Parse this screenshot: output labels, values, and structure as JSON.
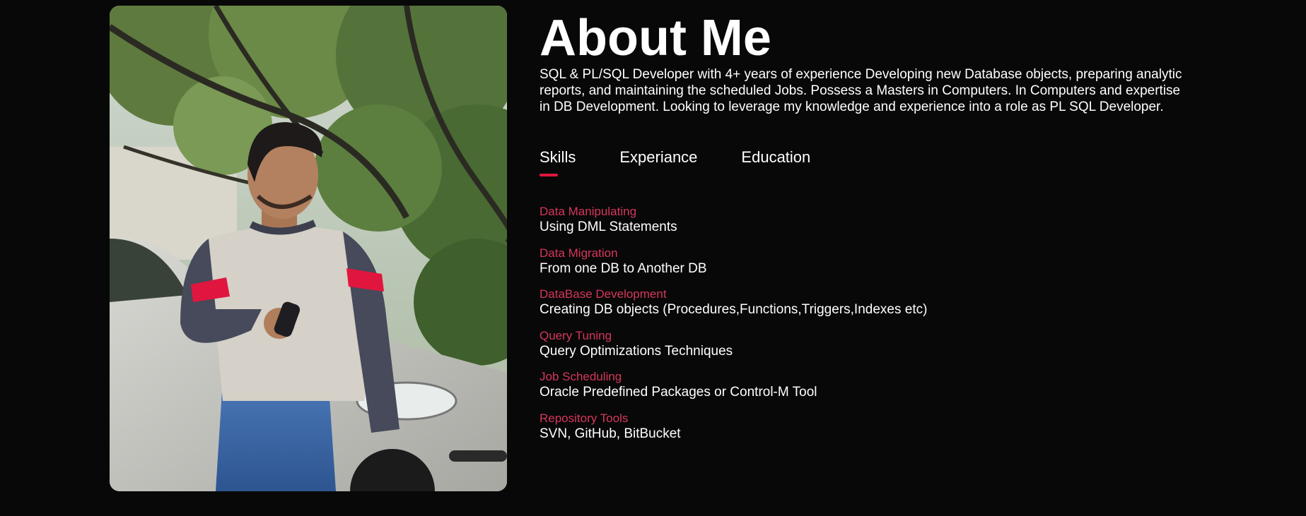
{
  "about": {
    "title": "About Me",
    "intro": "SQL & PL/SQL Developer with 4+ years of experience Developing new Database objects, preparing analytic reports, and maintaining the scheduled Jobs. Possess a Masters in Computers. In Computers and expertise in DB Development. Looking to leverage my knowledge and experience into a role as PL SQL Developer.",
    "photo_alt": "profile photo"
  },
  "tabs": [
    {
      "label": "Skills",
      "active": true
    },
    {
      "label": "Experiance",
      "active": false
    },
    {
      "label": "Education",
      "active": false
    }
  ],
  "skills": [
    {
      "name": "Data Manipulating",
      "desc": "Using DML Statements"
    },
    {
      "name": "Data Migration",
      "desc": "From one DB to Another DB"
    },
    {
      "name": "DataBase Development",
      "desc": "Creating DB objects (Procedures,Functions,Triggers,Indexes etc)"
    },
    {
      "name": "Query Tuning",
      "desc": "Query Optimizations Techniques"
    },
    {
      "name": "Job Scheduling",
      "desc": "Oracle Predefined Packages or Control-M Tool"
    },
    {
      "name": "Repository Tools",
      "desc": "SVN, GitHub, BitBucket"
    }
  ],
  "colors": {
    "background": "#080808",
    "accent": "#e0163f",
    "skill_name": "#d6375b",
    "text": "#ffffff"
  }
}
